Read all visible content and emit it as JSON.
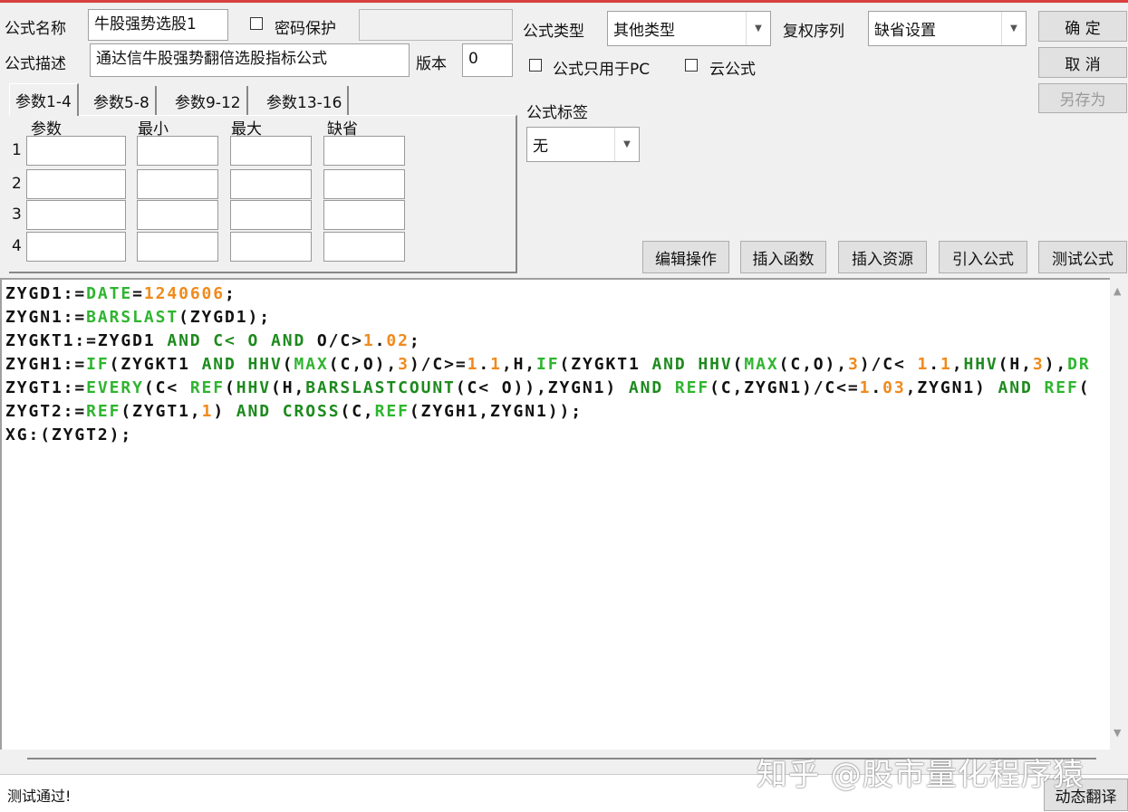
{
  "form": {
    "name_label": "公式名称",
    "name_value": "牛股强势选股1",
    "password_label": "密码保护",
    "password_value": "",
    "desc_label": "公式描述",
    "desc_value": "通达信牛股强势翻倍选股指标公式",
    "version_label": "版本",
    "version_value": "0",
    "type_label": "公式类型",
    "type_value": "其他类型",
    "rights_label": "复权序列",
    "rights_value": "缺省设置",
    "pc_only_label": "公式只用于PC",
    "cloud_label": "云公式",
    "tag_label": "公式标签",
    "tag_value": "无"
  },
  "buttons": {
    "ok": "确 定",
    "cancel": "取 消",
    "save_as": "另存为",
    "edit": "编辑操作",
    "insert_func": "插入函数",
    "insert_res": "插入资源",
    "import": "引入公式",
    "test": "测试公式",
    "translate": "动态翻译"
  },
  "tabs": [
    "参数1-4",
    "参数5-8",
    "参数9-12",
    "参数13-16"
  ],
  "params": {
    "headers": [
      "参数",
      "最小",
      "最大",
      "缺省"
    ],
    "rows": [
      "1",
      "2",
      "3",
      "4"
    ]
  },
  "code": [
    [
      [
        "ZYGD1:=",
        "k"
      ],
      [
        "DATE",
        "g"
      ],
      [
        "=",
        "k"
      ],
      [
        "1240606",
        "n"
      ],
      [
        ";",
        "k"
      ]
    ],
    [
      [
        "ZYGN1:=",
        "k"
      ],
      [
        "BARSLAST",
        "g"
      ],
      [
        "(ZYGD1);",
        "k"
      ]
    ],
    [
      [
        "ZYGKT1:=ZYGD1 ",
        "k"
      ],
      [
        "AND",
        "f"
      ],
      [
        " C< O ",
        "f"
      ],
      [
        "AND",
        "f"
      ],
      [
        " O/C>",
        "k"
      ],
      [
        "1",
        "n"
      ],
      [
        ".",
        "k"
      ],
      [
        "02",
        "n"
      ],
      [
        ";",
        "k"
      ]
    ],
    [
      [
        "ZYGH1:=",
        "k"
      ],
      [
        "IF",
        "g"
      ],
      [
        "(ZYGKT1 ",
        "k"
      ],
      [
        "AND",
        "f"
      ],
      [
        " ",
        "k"
      ],
      [
        "HHV",
        "f"
      ],
      [
        "(",
        "k"
      ],
      [
        "MAX",
        "g"
      ],
      [
        "(C,O),",
        "k"
      ],
      [
        "3",
        "n"
      ],
      [
        ")/C>=",
        "k"
      ],
      [
        "1",
        "n"
      ],
      [
        ".",
        "k"
      ],
      [
        "1",
        "n"
      ],
      [
        ",H,",
        "k"
      ],
      [
        "IF",
        "g"
      ],
      [
        "(ZYGKT1 ",
        "k"
      ],
      [
        "AND",
        "f"
      ],
      [
        " ",
        "k"
      ],
      [
        "HHV",
        "f"
      ],
      [
        "(",
        "k"
      ],
      [
        "MAX",
        "g"
      ],
      [
        "(C,O),",
        "k"
      ],
      [
        "3",
        "n"
      ],
      [
        ")/C< ",
        "k"
      ],
      [
        "1",
        "n"
      ],
      [
        ".",
        "k"
      ],
      [
        "1",
        "n"
      ],
      [
        ",",
        "k"
      ],
      [
        "HHV",
        "f"
      ],
      [
        "(H,",
        "k"
      ],
      [
        "3",
        "n"
      ],
      [
        "),",
        "k"
      ],
      [
        "DR",
        "g"
      ]
    ],
    [
      [
        "ZYGT1:=",
        "k"
      ],
      [
        "EVERY",
        "g"
      ],
      [
        "(C< ",
        "k"
      ],
      [
        "REF",
        "g"
      ],
      [
        "(",
        "k"
      ],
      [
        "HHV",
        "f"
      ],
      [
        "(H,",
        "k"
      ],
      [
        "BARSLASTCOUNT",
        "f"
      ],
      [
        "(C< O)),ZYGN1) ",
        "k"
      ],
      [
        "AND",
        "f"
      ],
      [
        " ",
        "k"
      ],
      [
        "REF",
        "g"
      ],
      [
        "(C,ZYGN1)/C<=",
        "k"
      ],
      [
        "1",
        "n"
      ],
      [
        ".",
        "k"
      ],
      [
        "03",
        "n"
      ],
      [
        ",ZYGN1) ",
        "k"
      ],
      [
        "AND",
        "f"
      ],
      [
        " ",
        "k"
      ],
      [
        "REF",
        "g"
      ],
      [
        "(",
        "k"
      ]
    ],
    [
      [
        "ZYGT2:=",
        "k"
      ],
      [
        "REF",
        "g"
      ],
      [
        "(ZYGT1,",
        "k"
      ],
      [
        "1",
        "n"
      ],
      [
        ") ",
        "k"
      ],
      [
        "AND",
        "f"
      ],
      [
        " ",
        "k"
      ],
      [
        "CROSS",
        "f"
      ],
      [
        "(C,",
        "k"
      ],
      [
        "REF",
        "g"
      ],
      [
        "(ZYGH1,ZYGN1));",
        "k"
      ]
    ],
    [
      [
        "XG:(ZYGT2);",
        "k"
      ]
    ]
  ],
  "status": {
    "message": "测试通过!"
  },
  "watermark": "知乎 @股市量化程序猿"
}
